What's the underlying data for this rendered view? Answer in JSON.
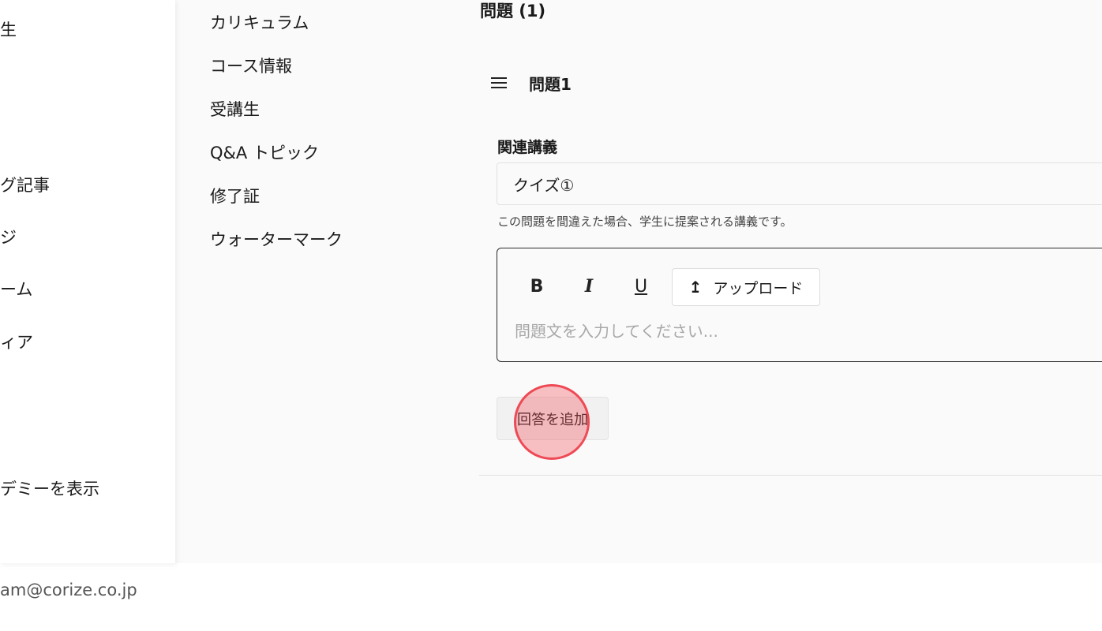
{
  "left_sidebar": {
    "items": [
      {
        "label": "生"
      },
      {
        "label": "グ記事"
      },
      {
        "label": "ジ"
      },
      {
        "label": "ーム"
      },
      {
        "label": "ィア"
      },
      {
        "label": "デミーを表示"
      }
    ]
  },
  "course_nav": {
    "items": [
      {
        "label": "カリキュラム"
      },
      {
        "label": "コース情報"
      },
      {
        "label": "受講生"
      },
      {
        "label": "Q&A トピック"
      },
      {
        "label": "修了証"
      },
      {
        "label": "ウォーターマーク"
      }
    ]
  },
  "questions": {
    "title": "問題 (1)",
    "question": {
      "title": "問題1",
      "related_lecture_label": "関連講義",
      "related_lecture_value": "クイズ①",
      "related_lecture_helper": "この問題を間違えた場合、学生に提案される講義です。",
      "editor": {
        "bold": "B",
        "italic": "I",
        "underline": "U",
        "upload_label": "アップロード",
        "upload_icon": "↥",
        "placeholder": "問題文を入力してください..."
      }
    },
    "add_answer_label": "回答を追加"
  },
  "footer": {
    "email": "am@corize.co.jp"
  },
  "colors": {
    "main_bg": "#fafafa",
    "editor_border": "#2a2a2a",
    "click_marker": "#ee4a55"
  }
}
